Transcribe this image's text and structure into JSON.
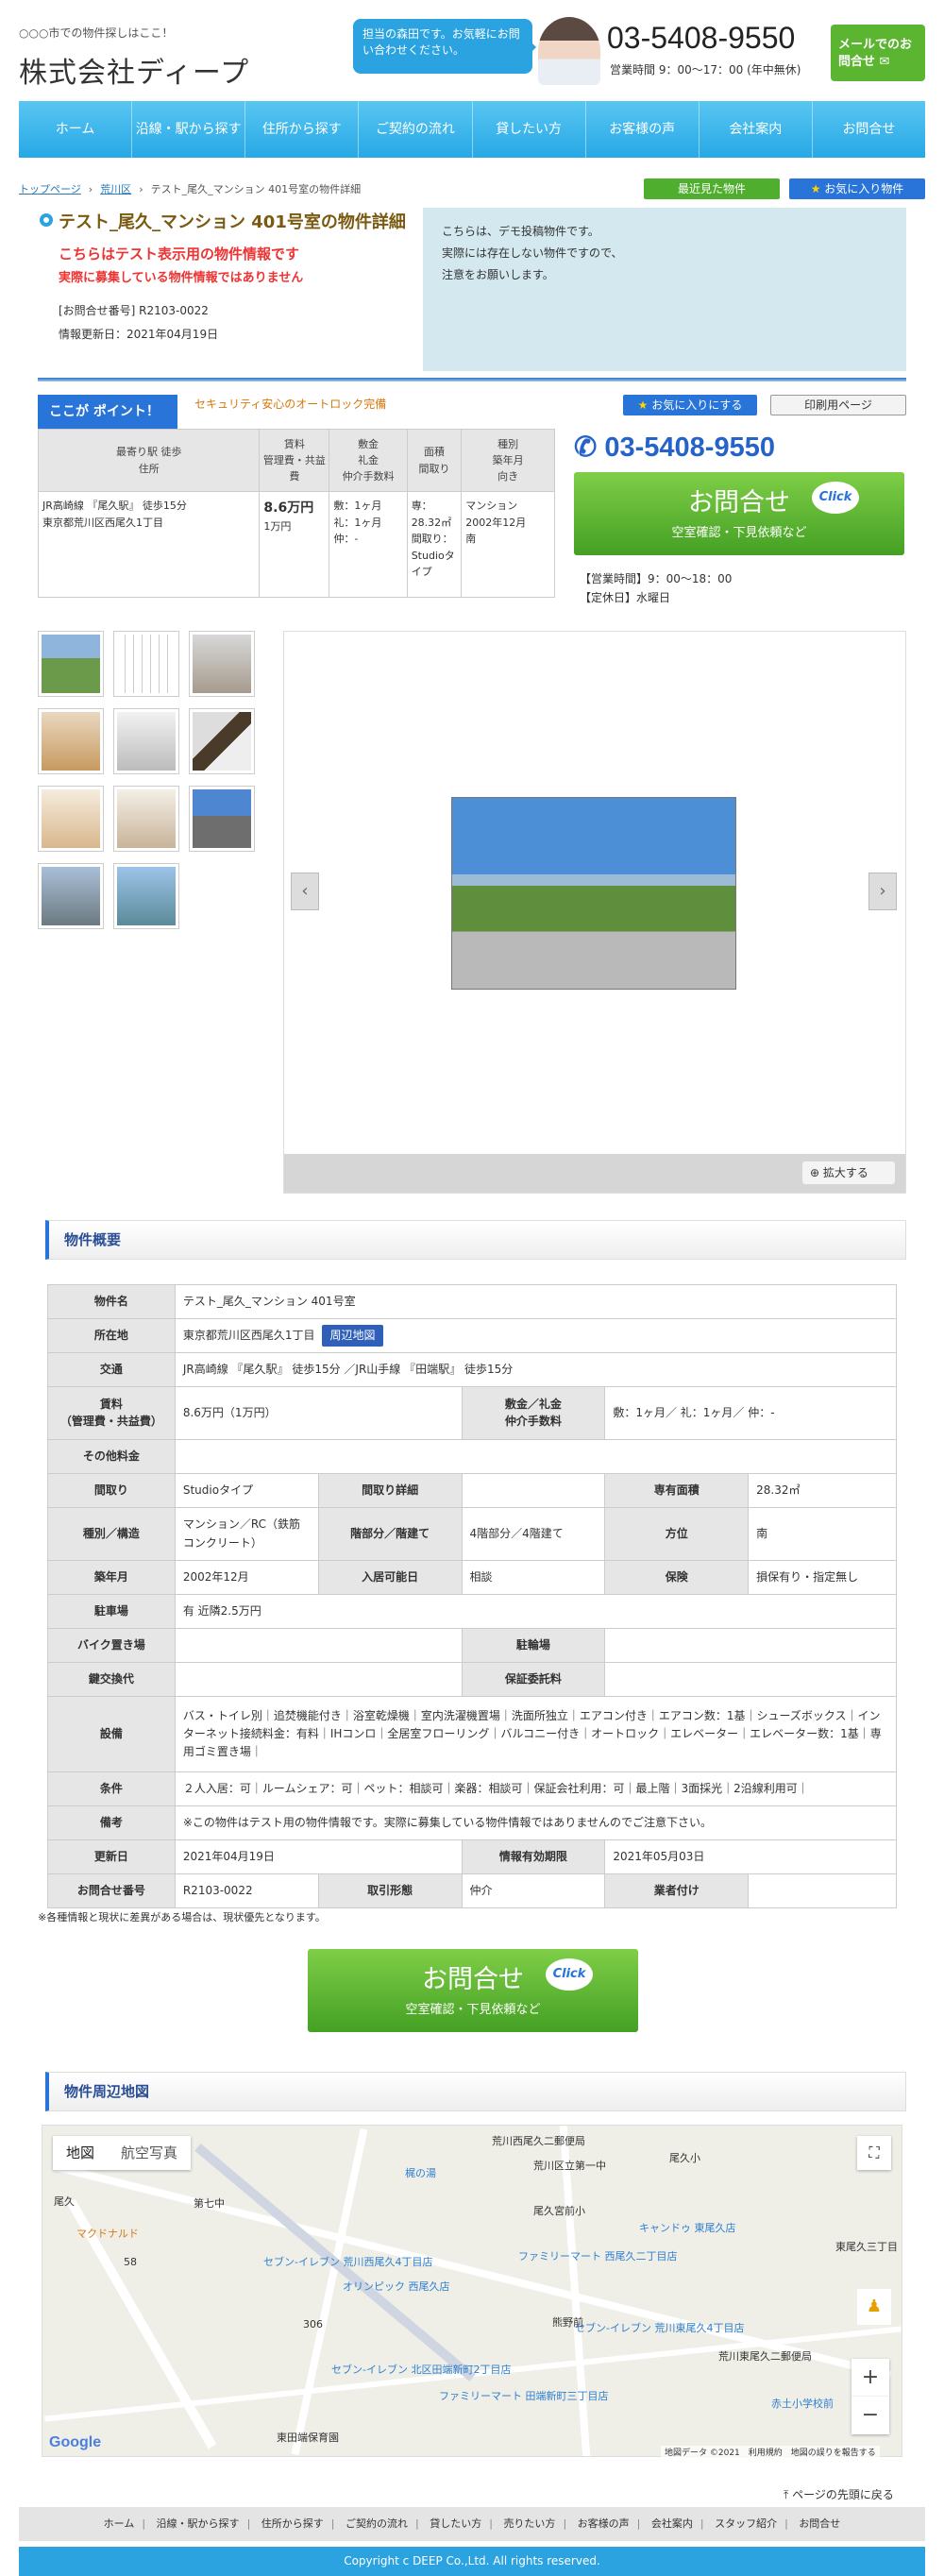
{
  "header": {
    "tagline": "○○○市での物件探しはここ！",
    "company": "株式会社ディープ",
    "bubble": "担当の森田です。お気軽にお問い合わせください。",
    "phone": "03-5408-9550",
    "hours": "営業時間 9：00〜17：00 (年中無休)",
    "mail_button": "メールでのお問合せ"
  },
  "nav": [
    "ホーム",
    "沿線・駅から探す",
    "住所から探す",
    "ご契約の流れ",
    "貸したい方",
    "お客様の声",
    "会社案内",
    "お問合せ"
  ],
  "breadcrumb": [
    "トップページ",
    "荒川区",
    "テスト_尾久_マンション 401号室の物件詳細"
  ],
  "buttons": {
    "recent": "最近見た物件",
    "fav_list": "お気に入り物件",
    "add_fav": "お気に入りにする",
    "print": "印刷用ページ",
    "zoom": "拡大する",
    "map_link": "周辺地図"
  },
  "property": {
    "title": "テスト_尾久_マンション 401号室の物件詳細",
    "notice1": "こちらはテスト表示用の物件情報です",
    "notice2": "実際に募集している物件情報ではありません",
    "inquiry_no": "[お問合せ番号] R2103-0022",
    "updated": "情報更新日：2021年04月19日",
    "notice_box": [
      "こちらは、デモ投稿物件です。",
      "実際には存在しない物件ですので、",
      "注意をお願いします。"
    ]
  },
  "point": {
    "badge": "ここが ポイント！",
    "text": "セキュリティ安心のオートロック完備"
  },
  "summary": {
    "headers": [
      "最寄り駅 徒歩\n住所",
      "賃料\n管理費・共益費",
      "敷金\n礼金\n仲介手数料",
      "面積\n間取り",
      "種別\n築年月\n向き"
    ],
    "station": "JR高崎線 『尾久駅』 徒歩15分",
    "address": "東京都荒川区西尾久1丁目",
    "rent": "8.6万円",
    "rent_sub": "1万円",
    "deposit": "敷：1ヶ月\n礼：1ヶ月\n仲：-",
    "area": "専：28.32㎡\n間取り：Studioタイプ",
    "type": "マンション\n2002年12月\n南"
  },
  "contact": {
    "phone": "03-5408-9550",
    "cta_main": "お問合せ",
    "cta_sub": "空室確認・下見依頼など",
    "click": "Click",
    "biz_hours": "【営業時間】9：00〜18：00",
    "closed": "【定休日】水曜日"
  },
  "sections": {
    "overview": "物件概要",
    "map": "物件周辺地図"
  },
  "detail": {
    "name_label": "物件名",
    "name": "テスト_尾久_マンション 401号室",
    "loc_label": "所在地",
    "loc": "東京都荒川区西尾久1丁目",
    "traffic_label": "交通",
    "traffic": "JR高崎線 『尾久駅』 徒歩15分 ／JR山手線 『田端駅』 徒歩15分",
    "rent_label": "賃料\n（管理費・共益費）",
    "rent": "8.6万円（1万円）",
    "deposit_label": "敷金／礼金\n仲介手数料",
    "deposit": "敷：1ヶ月／ 礼：1ヶ月／ 仲：-",
    "other_label": "その他料金",
    "layout_label": "間取り",
    "layout": "Studioタイプ",
    "layout_detail_label": "間取り詳細",
    "area_label": "専有面積",
    "area": "28.32㎡",
    "structure_label": "種別／構造",
    "structure": "マンション／RC（鉄筋コンクリート）",
    "floor_label": "階部分／階建て",
    "floor": "4階部分／4階建て",
    "dir_label": "方位",
    "dir": "南",
    "built_label": "築年月",
    "built": "2002年12月",
    "move_label": "入居可能日",
    "move": "相談",
    "ins_label": "保険",
    "ins": "損保有り・指定無し",
    "parking_label": "駐車場",
    "parking": "有 近隣2.5万円",
    "bike_label": "バイク置き場",
    "bicycle_label": "駐輪場",
    "key_label": "鍵交換代",
    "guarantee_label": "保証委託料",
    "equip_label": "設備",
    "equip": "バス・トイレ別｜追焚機能付き｜浴室乾燥機｜室内洗濯機置場｜洗面所独立｜エアコン付き｜エアコン数：1基｜シューズボックス｜インターネット接続料金：有料｜IHコンロ｜全居室フローリング｜バルコニー付き｜オートロック｜エレベーター｜エレベーター数：1基｜専用ゴミ置き場｜",
    "cond_label": "条件",
    "cond": "２人入居：可｜ルームシェア：可｜ペット：相談可｜楽器：相談可｜保証会社利用：可｜最上階｜3面採光｜2沿線利用可｜",
    "note_label": "備考",
    "note": "※この物件はテスト用の物件情報です。実際に募集している物件情報ではありませんのでご注意下さい。",
    "upd_label": "更新日",
    "upd": "2021年04月19日",
    "valid_label": "情報有効期限",
    "valid": "2021年05月03日",
    "inq_label": "お問合せ番号",
    "inq": "R2103-0022",
    "deal_label": "取引形態",
    "deal": "仲介",
    "agent_label": "業者付け"
  },
  "footnote": "※各種情報と現状に差異がある場合は、現状優先となります。",
  "map": {
    "tab_map": "地図",
    "tab_sat": "航空写真",
    "labels": [
      "荒川西尾久二郵便局",
      "尾久小",
      "荒川区立第一中",
      "尾久宮前小",
      "キャンドゥ 東尾久店",
      "セブン-イレブン 荒川西尾久4丁目店",
      "オリンピック 西尾久店",
      "マクドナルド",
      "ファミリーマート 西尾久二丁目店",
      "セブン-イレブン 荒川東尾久4丁目店",
      "荒川東尾久二郵便局",
      "赤土小学校前",
      "東田端保育園",
      "セブン-イレブン 北区田端新町2丁目店",
      "ファミリーマート 田端新町三丁目店",
      "第七中",
      "尾久",
      "熊野前",
      "東尾久三丁目",
      "梶の湯",
      "306",
      "58"
    ],
    "attribution": "地図データ ©2021　利用規約　地図の誤りを報告する",
    "google": "Google"
  },
  "pagetop": "ページの先頭に戻る",
  "footer_nav": [
    "ホーム",
    "沿線・駅から探す",
    "住所から探す",
    "ご契約の流れ",
    "貸したい方",
    "売りたい方",
    "お客様の声",
    "会社案内",
    "スタッフ紹介",
    "お問合せ"
  ],
  "copyright": "Copyright c DEEP Co.,Ltd. All rights reserved."
}
